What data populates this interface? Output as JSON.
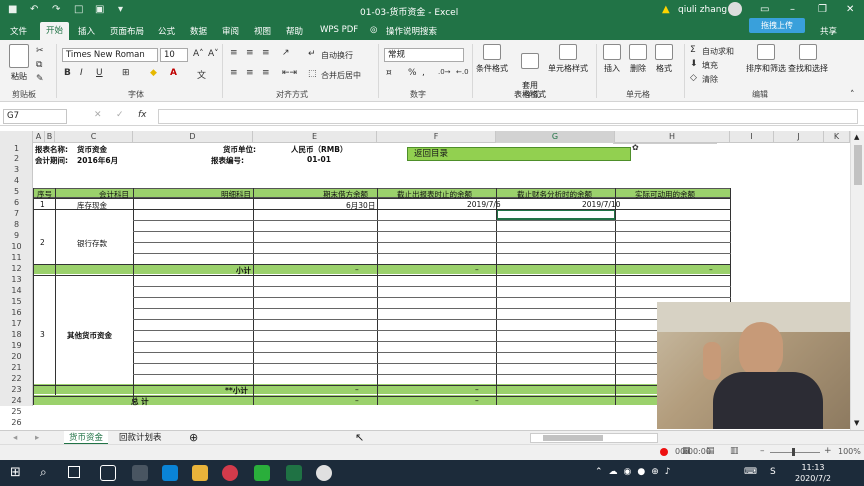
{
  "window": {
    "title": "01-03-货币资金  -  Excel",
    "user": "qiuli zhang",
    "upload_button": "拖拽上传",
    "share": "共享"
  },
  "menu_tabs": [
    "文件",
    "开始",
    "插入",
    "页面布局",
    "公式",
    "数据",
    "审阅",
    "视图",
    "帮助",
    "WPS PDF",
    "操作说明搜索"
  ],
  "active_tab": "开始",
  "ribbon": {
    "paste": "粘贴",
    "clipboard_group": "剪贴板",
    "font_name": "Times New Roman",
    "font_size": "10",
    "font_group": "字体",
    "wrap_text": "自动换行",
    "merge_center": "合并后居中",
    "alignment_group": "对齐方式",
    "number_format": "常规",
    "number_group": "数字",
    "cond_format": "条件格式",
    "format_table": "套用\n表格格式",
    "cell_styles": "单元格样式",
    "styles_group": "样式",
    "insert": "插入",
    "delete": "删除",
    "format": "格式",
    "cells_group": "单元格",
    "autosum": "自动求和",
    "fill": "填充",
    "clear": "清除",
    "sort_filter": "排序和筛选",
    "find_select": "查找和选择",
    "editing_group": "编辑"
  },
  "formula_bar": {
    "name_box": "G7",
    "formula": "",
    "fx": "fx"
  },
  "columns": [
    "A",
    "B",
    "C",
    "D",
    "E",
    "F",
    "G",
    "H",
    "I",
    "J",
    "K"
  ],
  "selected_column": "G",
  "rows": [
    "1",
    "2",
    "3",
    "4",
    "5",
    "6",
    "7",
    "8",
    "9",
    "10",
    "11",
    "12",
    "13",
    "14",
    "15",
    "16",
    "17",
    "18",
    "19",
    "20",
    "21",
    "22",
    "23",
    "24",
    "25",
    "26"
  ],
  "sheet": {
    "r1_label": "报表名称:",
    "r1_value": "货币资金",
    "r1_unit_label": "货币单位:",
    "r1_unit_value": "人民币（RMB）",
    "r2_label": "会计期间:",
    "r2_value": "2016年6月",
    "r2_code_label": "报表编号:",
    "r2_code_value": "01-01",
    "back_button": "返回目录",
    "headers": [
      "序号",
      "会计科目",
      "明细科目",
      "期末借方余额",
      "截止出报表时止的余额",
      "截止财务分析时的余额",
      "实际可动用的余额"
    ],
    "r6": {
      "seq": "1",
      "account": "库存现金",
      "e": "6月30日",
      "f": "2019/7/6",
      "g": "2019/7/10"
    },
    "group2": {
      "seq": "2",
      "account": "银行存款",
      "subtotal": "小计",
      "dash": "–"
    },
    "group3": {
      "seq": "3",
      "account": "其他货币资金",
      "subtotal": "**小计",
      "dash": "–"
    },
    "total": "总   计",
    "dash": "–"
  },
  "wps_toolbar": "五 ☽ • ⌨ ♦ ✿",
  "sheets": [
    "货币资金",
    "回款计划表"
  ],
  "active_sheet": "货币资金",
  "status": {
    "rec_time": "00:00:00",
    "zoom": "100%"
  },
  "clock": {
    "time": "11:13",
    "date": "2020/7/2"
  }
}
